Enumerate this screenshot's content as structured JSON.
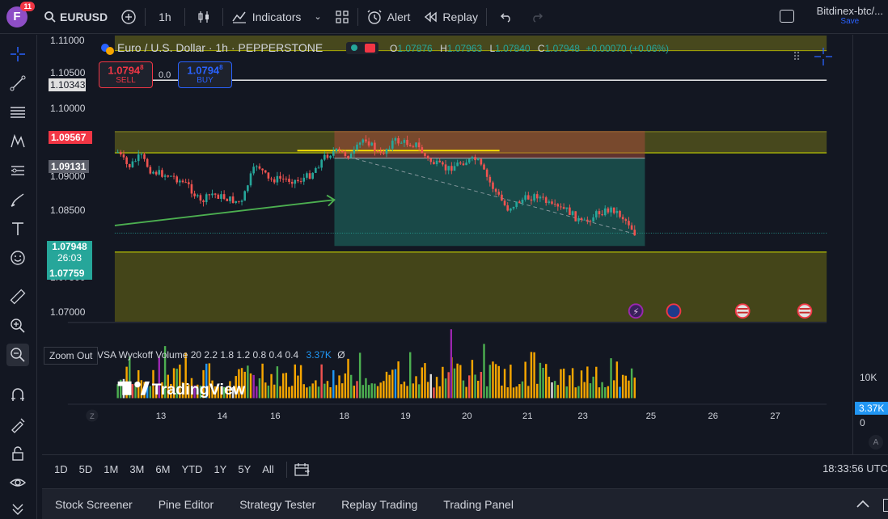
{
  "topbar": {
    "avatar_letter": "F",
    "notifications": "11",
    "symbol": "EURUSD",
    "interval": "1h",
    "indicators_label": "Indicators",
    "alert_label": "Alert",
    "replay_label": "Replay",
    "layout_name": "Bitdinex-btc/...",
    "layout_save": "Save"
  },
  "legend": {
    "title": "Euro / U.S. Dollar · 1h · PEPPERSTONE",
    "ohlc": {
      "o_label": "O",
      "o": "1.07876",
      "h_label": "H",
      "h": "1.07963",
      "l_label": "L",
      "l": "1.07840",
      "c_label": "C",
      "c": "1.07948",
      "change": "+0.00070 (+0.06%)"
    },
    "sell_price": "1.0794",
    "sell_sup": "8",
    "sell_label": "SELL",
    "spread": "0.0",
    "buy_price": "1.0794",
    "buy_sup": "8",
    "buy_label": "BUY"
  },
  "price_axis": {
    "ticks": [
      "1.11000",
      "1.10500",
      "1.10000",
      "1.08500",
      "1.07000"
    ],
    "labels": {
      "white_line": "1.10343",
      "red_top": "1.09567",
      "gray_mid": "1.09131",
      "current": "1.07948",
      "countdown": "26:03",
      "green_low": "1.07759",
      "partial_900": "1.09000",
      "partial_750": "1.07500"
    }
  },
  "volume": {
    "legend": "VSA Wyckoff Volume 20 2.2 1.8 1.2 0.8 0.4 0.4",
    "value": "3.37K",
    "symbol": "Ø",
    "axis_10k": "10K",
    "axis_0": "0",
    "watermark": "TradingView"
  },
  "time_axis": {
    "ticks": [
      "13",
      "14",
      "16",
      "18",
      "19",
      "20",
      "21",
      "23",
      "25",
      "26",
      "27"
    ],
    "z_button": "Z",
    "a_button": "A"
  },
  "tooltip": "Zoom Out",
  "range_bar": {
    "items": [
      "1D",
      "5D",
      "1M",
      "3M",
      "6M",
      "YTD",
      "1Y",
      "5Y",
      "All"
    ],
    "clock": "18:33:56 UTC"
  },
  "panel_bar": {
    "items": [
      "Stock Screener",
      "Pine Editor",
      "Strategy Tester",
      "Replay Trading",
      "Trading Panel"
    ]
  },
  "colors": {
    "bg": "#131722",
    "up": "#26a69a",
    "down": "#ef5350",
    "accent": "#2962ff",
    "zone_yellow": "#6b6b1f",
    "zone_red": "#7a3a33",
    "zone_teal": "#1d5a55"
  }
}
